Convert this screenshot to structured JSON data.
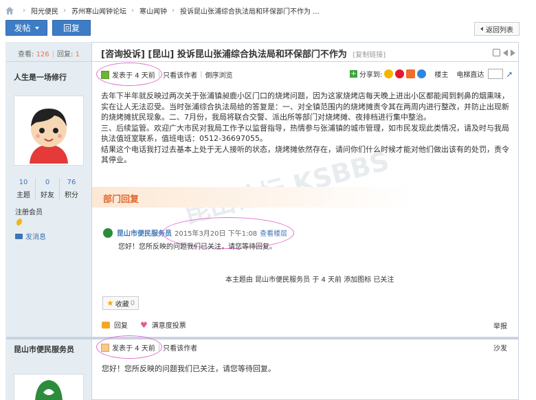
{
  "breadcrumb": [
    "阳光便民",
    "苏州寒山闻钟论坛",
    "寒山闻钟",
    "投诉昆山张浦综合执法局和环保部门不作为 ..."
  ],
  "toolbar": {
    "post_label": "发帖",
    "reply_label": "回复",
    "back_label": "返回列表"
  },
  "thread": {
    "views_label": "查看:",
    "views": "126",
    "replies_label": "回复:",
    "replies": "1",
    "title": "[咨询投诉] [昆山] 投诉昆山张浦综合执法局和环保部门不作为",
    "copy_link": "[复制链接]"
  },
  "post1": {
    "author": "人生是一场修行",
    "stats": [
      {
        "value": "10",
        "label": "主题"
      },
      {
        "value": "0",
        "label": "好友"
      },
      {
        "value": "76",
        "label": "积分"
      }
    ],
    "group": "注册会员",
    "send_message": "发消息",
    "posted": "发表于 4 天前",
    "only_author": "只看该作者",
    "reverse": "倒序浏览",
    "share_label": "分享到:",
    "floor": "楼主",
    "jump_label": "电梯直达",
    "paragraphs": [
      "去年下半年就反映过两次关于张浦镇昶鹿小区门口的烧烤问题，因为这家烧烤店每天晚上进出小区都能闻到刺鼻的烟熏味，实在让人无法忍受。当时张浦综合执法局给的答复是：一、对全镇范围内的烧烤摊责令其在两周内进行整改，并防止出现新的烧烤摊扰民现象。二、7月份，我局将联合交警、派出所等部门对烧烤摊、夜排档进行集中整治。",
      "三、后续监管。欢迎广大市民对我局工作予以监督指导，热情参与张浦镇的城市管理，如市民发现此类情况，请及时与我局执法值班室联系，值班电话：0512-36697055。",
      "结果这个电话我打过去基本上处于无人接听的状态，烧烤摊依然存在，请问你们什么时候才能对他们做出该有的处罚，责令其停业。"
    ],
    "reply_section": "部门回复",
    "quote_author": "昆山市便民服务员",
    "quote_date": "2015年3月20日 下午1:08",
    "quote_view": "查看楼层",
    "quote_text": "您好！您所反映的问题我们已关注，请您等待回复。",
    "watermark": "昆山论坛 KSBBS",
    "topic_note": "本主题由 昆山市便民服务员 于 4 天前 添加图标 已关注",
    "favorite_label": "收藏",
    "favorite_count": "0",
    "reply_action": "回复",
    "rate_action": "满意度投票",
    "report": "举报"
  },
  "post2": {
    "author": "昆山市便民服务员",
    "posted": "发表于 4 天前",
    "only_author": "只看该作者",
    "floor": "沙发",
    "body": "您好！您所反映的问题我们已关注，请您等待回复。"
  }
}
